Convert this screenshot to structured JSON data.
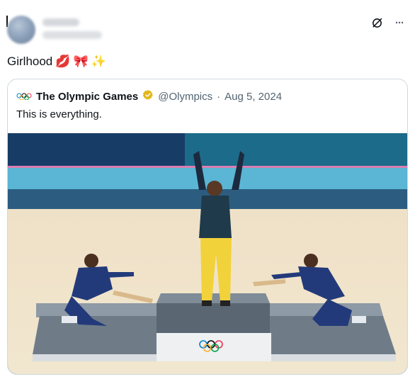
{
  "post": {
    "text": "Girlhood",
    "emojis": [
      "💋",
      "🎀",
      "✨"
    ]
  },
  "top_icons": [
    "grok-icon",
    "more-icon"
  ],
  "more_label": "···",
  "quoted": {
    "name": "The Olympic Games",
    "handle": "@Olympics",
    "separator": "·",
    "date": "Aug 5, 2024",
    "text": "This is everything.",
    "verified_color": "#e2b719"
  },
  "photo": {
    "description_icons": [
      "olympic-rings-icon"
    ]
  }
}
